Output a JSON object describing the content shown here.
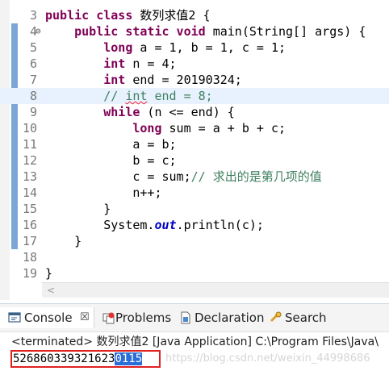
{
  "editor": {
    "lines": [
      {
        "num": "3",
        "current": false,
        "fold": "",
        "changed": false,
        "tokens": [
          {
            "t": "kw",
            "v": "public class"
          },
          {
            "t": "n",
            "v": " 数列求值2 {"
          }
        ]
      },
      {
        "num": "4",
        "current": false,
        "fold": "⊖",
        "changed": true,
        "tokens": [
          {
            "t": "n",
            "v": "    "
          },
          {
            "t": "kw",
            "v": "public static void"
          },
          {
            "t": "n",
            "v": " main(String[] args) {"
          }
        ]
      },
      {
        "num": "5",
        "current": false,
        "fold": "",
        "changed": true,
        "tokens": [
          {
            "t": "n",
            "v": "        "
          },
          {
            "t": "kw",
            "v": "long"
          },
          {
            "t": "n",
            "v": " a = 1, b = 1, c = 1;"
          }
        ]
      },
      {
        "num": "6",
        "current": false,
        "fold": "",
        "changed": true,
        "tokens": [
          {
            "t": "n",
            "v": "        "
          },
          {
            "t": "kw",
            "v": "int"
          },
          {
            "t": "n",
            "v": " n = 4;"
          }
        ]
      },
      {
        "num": "7",
        "current": false,
        "fold": "",
        "changed": true,
        "tokens": [
          {
            "t": "n",
            "v": "        "
          },
          {
            "t": "kw",
            "v": "int"
          },
          {
            "t": "n",
            "v": " end = 20190324;"
          }
        ]
      },
      {
        "num": "8",
        "current": true,
        "fold": "",
        "changed": true,
        "tokens": [
          {
            "t": "n",
            "v": "        "
          },
          {
            "t": "cmt",
            "v": "// "
          },
          {
            "t": "cmtsq",
            "v": "int"
          },
          {
            "t": "cmt",
            "v": " end = 8;"
          }
        ]
      },
      {
        "num": "9",
        "current": false,
        "fold": "",
        "changed": true,
        "tokens": [
          {
            "t": "n",
            "v": "        "
          },
          {
            "t": "kw",
            "v": "while"
          },
          {
            "t": "n",
            "v": " (n <= end) {"
          }
        ]
      },
      {
        "num": "10",
        "current": false,
        "fold": "",
        "changed": true,
        "tokens": [
          {
            "t": "n",
            "v": "            "
          },
          {
            "t": "kw",
            "v": "long"
          },
          {
            "t": "n",
            "v": " sum = a + b + c;"
          }
        ]
      },
      {
        "num": "11",
        "current": false,
        "fold": "",
        "changed": true,
        "tokens": [
          {
            "t": "n",
            "v": "            a = b;"
          }
        ]
      },
      {
        "num": "12",
        "current": false,
        "fold": "",
        "changed": true,
        "tokens": [
          {
            "t": "n",
            "v": "            b = c;"
          }
        ]
      },
      {
        "num": "13",
        "current": false,
        "fold": "",
        "changed": true,
        "tokens": [
          {
            "t": "n",
            "v": "            c = sum;"
          },
          {
            "t": "cmt",
            "v": "// 求出的是第几项的值"
          }
        ]
      },
      {
        "num": "14",
        "current": false,
        "fold": "",
        "changed": true,
        "tokens": [
          {
            "t": "n",
            "v": "            n++;"
          }
        ]
      },
      {
        "num": "15",
        "current": false,
        "fold": "",
        "changed": true,
        "tokens": [
          {
            "t": "n",
            "v": "        }"
          }
        ]
      },
      {
        "num": "16",
        "current": false,
        "fold": "",
        "changed": true,
        "tokens": [
          {
            "t": "n",
            "v": "        System."
          },
          {
            "t": "fld",
            "v": "out"
          },
          {
            "t": "n",
            "v": ".println(c);"
          }
        ]
      },
      {
        "num": "17",
        "current": false,
        "fold": "",
        "changed": true,
        "tokens": [
          {
            "t": "n",
            "v": "    }"
          }
        ]
      },
      {
        "num": "18",
        "current": false,
        "fold": "",
        "changed": false,
        "tokens": [
          {
            "t": "n",
            "v": ""
          }
        ]
      },
      {
        "num": "19",
        "current": false,
        "fold": "",
        "changed": false,
        "tokens": [
          {
            "t": "n",
            "v": "}"
          }
        ]
      }
    ],
    "scroll_left_arrow": "<"
  },
  "console": {
    "tabs": [
      {
        "label": "Console",
        "icon": "console-icon",
        "active": true,
        "close": "☒"
      },
      {
        "label": "Problems",
        "icon": "problems-icon",
        "active": false
      },
      {
        "label": "Declaration",
        "icon": "declaration-icon",
        "active": false
      },
      {
        "label": "Search",
        "icon": "search-icon",
        "active": false
      }
    ],
    "status": "<terminated> 数列求值2 [Java Application] C:\\Program Files\\Java\\",
    "output_plain": "526860339321623",
    "output_selected": "0115",
    "watermark": "https://blog.csdn.net/weixin_44998686"
  },
  "colors": {
    "keyword": "#7f0055",
    "comment": "#3f7f5f",
    "field": "#0000c0",
    "current_line": "#e8f2fe",
    "selection": "#2b6ed8",
    "highlight_box": "#e02020"
  }
}
